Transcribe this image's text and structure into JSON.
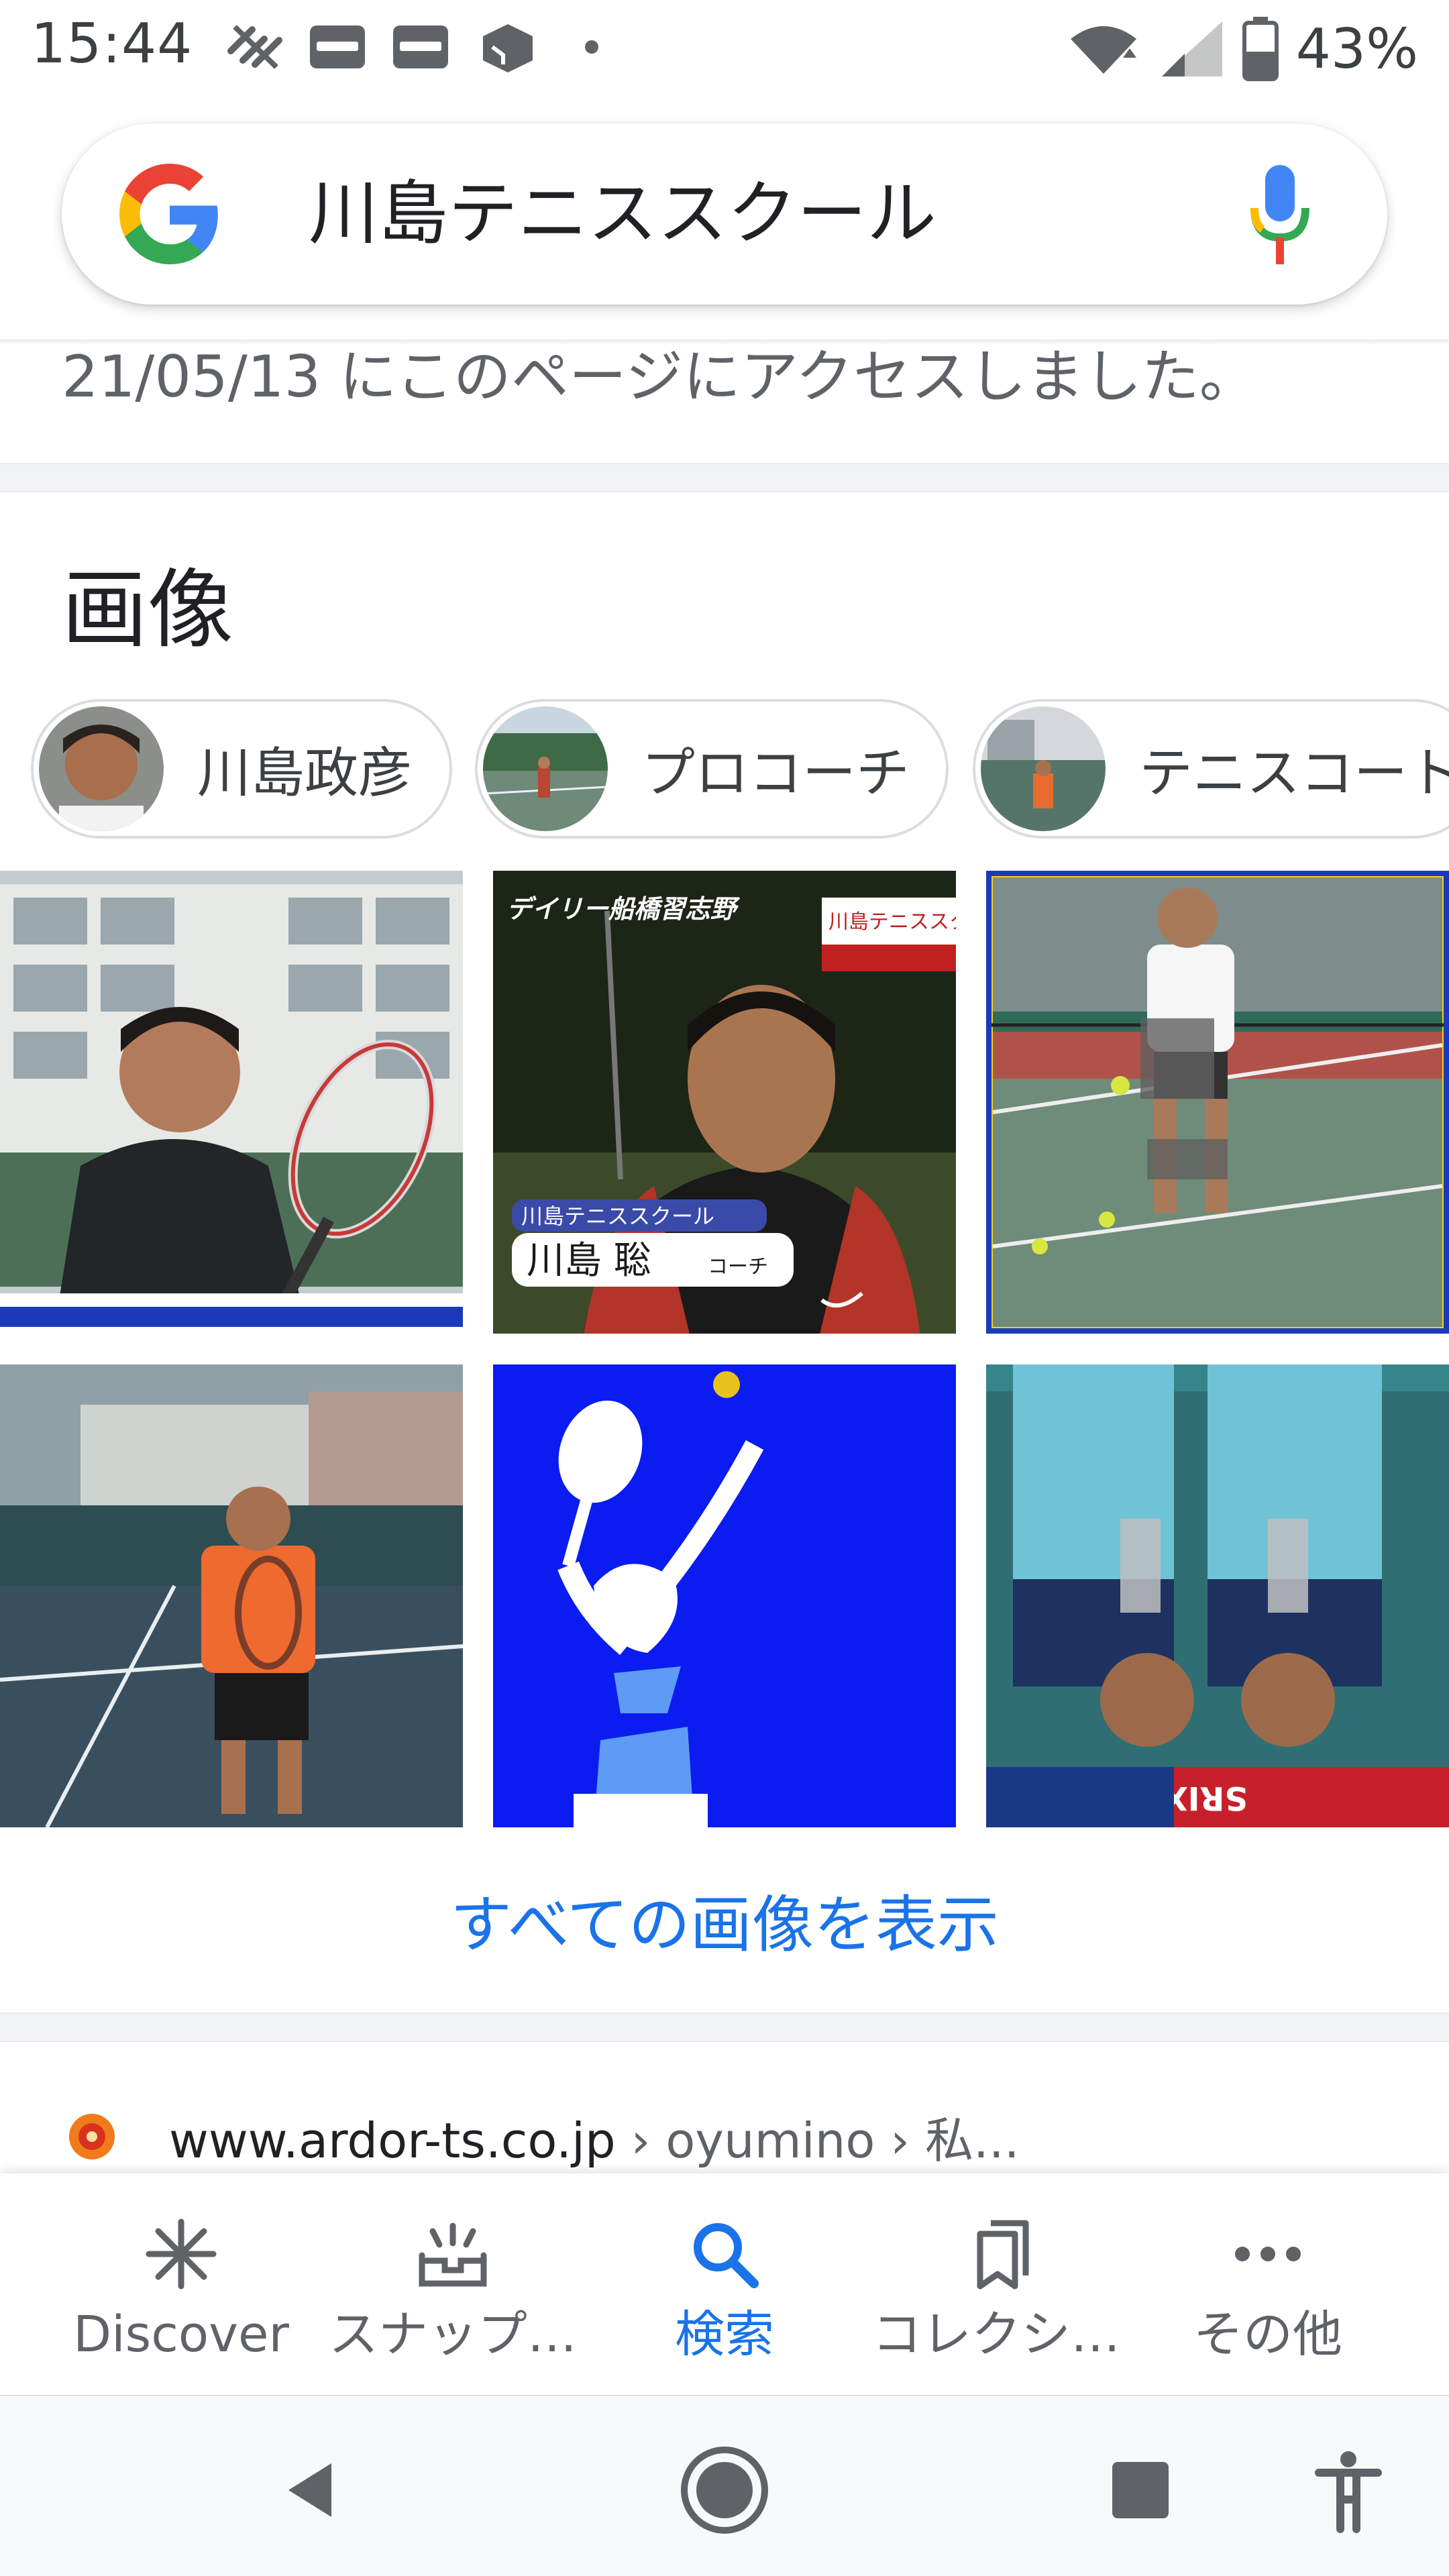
{
  "status_bar": {
    "time": "15:44",
    "notification_icons": [
      "mobile-data-off-icon",
      "pass-app-icon",
      "pass-app-icon",
      "cube-app-icon",
      "dot-more-icon"
    ],
    "battery_percent": "43%"
  },
  "search": {
    "query": "川島テニススクール",
    "logo": "google-g-logo",
    "voice_icon": "mic-icon"
  },
  "previous_result": {
    "visited_note": "21/05/13 にこのページにアクセスしました。"
  },
  "images_section": {
    "title": "画像",
    "chips": [
      {
        "label": "川島政彦"
      },
      {
        "label": "プロコーチ"
      },
      {
        "label": "テニスコート"
      }
    ],
    "image_captions": {
      "img2_top_left": "デイリー船橋習志野",
      "img2_top_right": "川島テニススク",
      "img2_school": "川島テニススクール",
      "img2_name": "川島 聡",
      "img2_role": "コーチ",
      "img6_sponsor": "SRIXON"
    },
    "view_all": "すべての画像を表示"
  },
  "result": {
    "domain": "www.ardor-ts.co.jp",
    "path": " › oyumino › 私..."
  },
  "bottom_nav": {
    "items": [
      {
        "label": "Discover",
        "icon": "asterisk-icon",
        "active": false
      },
      {
        "label": "スナップ…",
        "icon": "snapshot-tray-icon",
        "active": false
      },
      {
        "label": "検索",
        "icon": "search-icon",
        "active": true
      },
      {
        "label": "コレクシ…",
        "icon": "collections-bookmark-icon",
        "active": false
      },
      {
        "label": "その他",
        "icon": "more-dots-icon",
        "active": false
      }
    ]
  },
  "colors": {
    "accent": "#1a73e8",
    "text_primary": "#202124",
    "text_secondary": "#5f6368"
  }
}
